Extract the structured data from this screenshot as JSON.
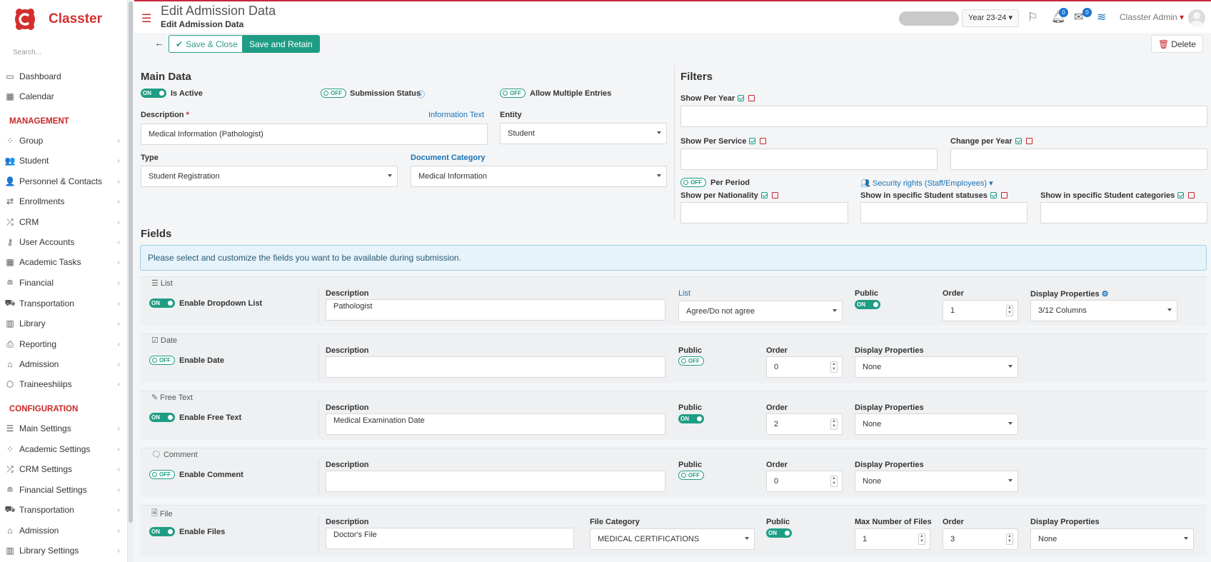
{
  "app": {
    "name": "Classter",
    "search_placeholder": "Search..."
  },
  "sidebar": {
    "items_top": [
      {
        "label": "Dashboard",
        "icon": "laptop-icon"
      },
      {
        "label": "Calendar",
        "icon": "calendar-icon"
      }
    ],
    "management_label": "MANAGEMENT",
    "management": [
      {
        "label": "Group",
        "icon": "group-icon"
      },
      {
        "label": "Student",
        "icon": "student-icon"
      },
      {
        "label": "Personnel & Contacts",
        "icon": "personnel-icon"
      },
      {
        "label": "Enrollments",
        "icon": "enrollments-icon"
      },
      {
        "label": "CRM",
        "icon": "crm-icon"
      },
      {
        "label": "User Accounts",
        "icon": "key-icon"
      },
      {
        "label": "Academic Tasks",
        "icon": "grid-icon"
      },
      {
        "label": "Financial",
        "icon": "coins-icon"
      },
      {
        "label": "Transportation",
        "icon": "bus-icon"
      },
      {
        "label": "Library",
        "icon": "library-icon"
      },
      {
        "label": "Reporting",
        "icon": "printer-icon"
      },
      {
        "label": "Admission",
        "icon": "building-icon"
      },
      {
        "label": "Traineeshiiips",
        "icon": "cube-icon"
      }
    ],
    "configuration_label": "CONFIGURATION",
    "configuration": [
      {
        "label": "Main Settings",
        "icon": "sliders-icon"
      },
      {
        "label": "Academic Settings",
        "icon": "group-icon"
      },
      {
        "label": "CRM Settings",
        "icon": "crm-icon"
      },
      {
        "label": "Financial Settings",
        "icon": "coins-icon"
      },
      {
        "label": "Transportation",
        "icon": "bus-icon"
      },
      {
        "label": "Admission",
        "icon": "building-icon"
      },
      {
        "label": "Library Settings",
        "icon": "library-icon"
      }
    ]
  },
  "header": {
    "title": "Edit Admission Data",
    "subtitle": "Edit Admission Data",
    "year": "Year 23-24",
    "notifications_count": "0",
    "messages_count": "0",
    "user": "Classter Admin"
  },
  "toolbar": {
    "save_close": "Save & Close",
    "save_retain": "Save and Retain",
    "delete": "Delete"
  },
  "main": {
    "title": "Main Data",
    "is_active": {
      "state": "ON",
      "label": "Is Active"
    },
    "submission_status": {
      "state": "OFF",
      "label": "Submission Status"
    },
    "allow_multiple": {
      "state": "OFF",
      "label": "Allow Multiple Entries"
    },
    "description_label": "Description",
    "required_mark": "*",
    "information_text": "Information Text",
    "description_value": "Medical Information (Pathologist)",
    "entity_label": "Entity",
    "entity_value": "Student",
    "type_label": "Type",
    "type_value": "Student Registration",
    "doc_cat_label": "Document Category",
    "doc_cat_value": "Medical Information"
  },
  "filters": {
    "title": "Filters",
    "per_year": "Show Per Year",
    "per_service": "Show Per Service",
    "change_per_year": "Change per Year",
    "per_period": {
      "state": "OFF",
      "label": "Per Period"
    },
    "security_rights": "Security rights (Staff/Employees)",
    "per_nationality": "Show per Nationality",
    "student_statuses": "Show in specific Student statuses",
    "student_categories": "Show in specific Student categories"
  },
  "fields": {
    "title": "Fields",
    "info": "Please select and customize the fields you want to be available during submission.",
    "list": {
      "title": "List",
      "toggle": "ON",
      "enable_label": "Enable Dropdown List",
      "description_label": "Description",
      "description": "Pathologist",
      "list_label": "List",
      "list_value": "Agree/Do not agree",
      "public_label": "Public",
      "public": "ON",
      "order_label": "Order",
      "order": "1",
      "display_label": "Display Properties",
      "display": "3/12 Columns"
    },
    "date": {
      "title": "Date",
      "toggle": "OFF",
      "enable_label": "Enable Date",
      "description_label": "Description",
      "description": "",
      "public_label": "Public",
      "public": "OFF",
      "order_label": "Order",
      "order": "0",
      "display_label": "Display Properties",
      "display": "None"
    },
    "free_text": {
      "title": "Free Text",
      "toggle": "ON",
      "enable_label": "Enable Free Text",
      "description_label": "Description",
      "description": "Medical Examination Date",
      "public_label": "Public",
      "public": "ON",
      "order_label": "Order",
      "order": "2",
      "display_label": "Display Properties",
      "display": "None"
    },
    "comment": {
      "title": "Comment",
      "toggle": "OFF",
      "enable_label": "Enable Comment",
      "description_label": "Description",
      "description": "",
      "public_label": "Public",
      "public": "OFF",
      "order_label": "Order",
      "order": "0",
      "display_label": "Display Properties",
      "display": "None"
    },
    "file": {
      "title": "File",
      "toggle": "ON",
      "enable_label": "Enable Files",
      "description_label": "Description",
      "description": "Doctor's File",
      "file_cat_label": "File Category",
      "file_cat": "MEDICAL CERTIFICATIONS",
      "public_label": "Public",
      "public": "ON",
      "max_files_label": "Max Number of Files",
      "max_files": "1",
      "order_label": "Order",
      "order": "3",
      "display_label": "Display Properties",
      "display": "None"
    }
  },
  "colors": {
    "brand": "#d32f2f",
    "accent": "#1f9d84",
    "link": "#1a73b5"
  }
}
